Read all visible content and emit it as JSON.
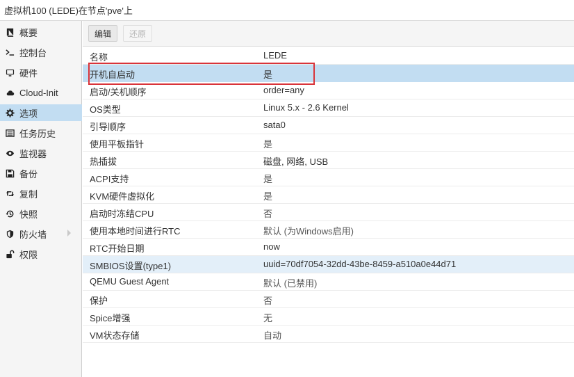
{
  "window": {
    "title": "虚拟机100 (LEDE)在节点'pve'上"
  },
  "sidebar": {
    "items": [
      {
        "label": "概要",
        "icon": "book-icon"
      },
      {
        "label": "控制台",
        "icon": "terminal-icon"
      },
      {
        "label": "硬件",
        "icon": "monitor-icon"
      },
      {
        "label": "Cloud-Init",
        "icon": "cloud-icon"
      },
      {
        "label": "选项",
        "icon": "gear-icon",
        "active": true
      },
      {
        "label": "任务历史",
        "icon": "list-icon"
      },
      {
        "label": "监视器",
        "icon": "eye-icon"
      },
      {
        "label": "备份",
        "icon": "floppy-icon"
      },
      {
        "label": "复制",
        "icon": "retweet-icon"
      },
      {
        "label": "快照",
        "icon": "history-icon"
      },
      {
        "label": "防火墙",
        "icon": "shield-icon",
        "expandable": true
      },
      {
        "label": "权限",
        "icon": "unlock-icon"
      }
    ]
  },
  "toolbar": {
    "edit_label": "编辑",
    "revert_label": "还原"
  },
  "options": {
    "rows": [
      {
        "key": "名称",
        "value": "LEDE"
      },
      {
        "key": "开机自启动",
        "value": "是"
      },
      {
        "key": "启动/关机顺序",
        "value": "order=any"
      },
      {
        "key": "OS类型",
        "value": "Linux 5.x - 2.6 Kernel"
      },
      {
        "key": "引导顺序",
        "value": "sata0"
      },
      {
        "key": "使用平板指针",
        "value": "是"
      },
      {
        "key": "热插拔",
        "value": "磁盘, 网络, USB"
      },
      {
        "key": "ACPI支持",
        "value": "是"
      },
      {
        "key": "KVM硬件虚拟化",
        "value": "是"
      },
      {
        "key": "启动时冻结CPU",
        "value": "否"
      },
      {
        "key": "使用本地时间进行RTC",
        "value": "默认 (为Windows启用)"
      },
      {
        "key": "RTC开始日期",
        "value": "now"
      },
      {
        "key": "SMBIOS设置(type1)",
        "value": "uuid=70df7054-32dd-43be-8459-a510a0e44d71"
      },
      {
        "key": "QEMU Guest Agent",
        "value": "默认 (已禁用)"
      },
      {
        "key": "保护",
        "value": "否"
      },
      {
        "key": "Spice增强",
        "value": "无"
      },
      {
        "key": "VM状态存储",
        "value": "自动"
      }
    ]
  },
  "colors": {
    "selected_row": "#c2ddf2",
    "hover_row": "#e3eff9",
    "annotation_box": "#d9343a"
  }
}
